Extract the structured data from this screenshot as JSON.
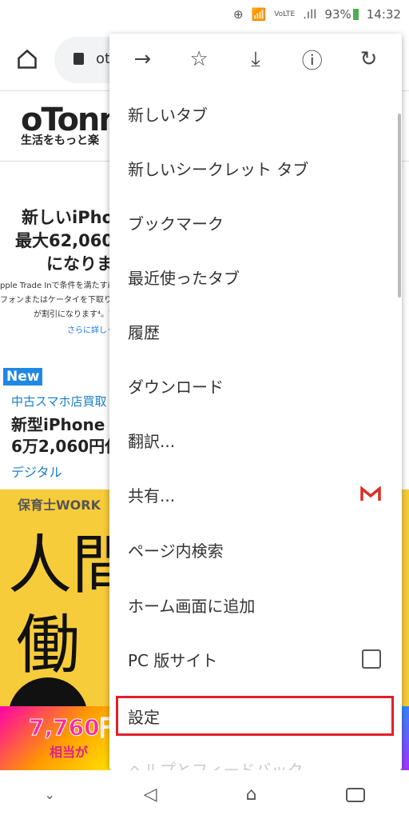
{
  "status_bar": {
    "battery": "93%",
    "time": "14:32",
    "icons": [
      "add-circle-icon",
      "wifi-icon",
      "volte-icon",
      "signal-icon",
      "battery-icon"
    ]
  },
  "toolbar": {
    "url_partial": "ot",
    "icons": [
      "home-icon",
      "lock-icon"
    ]
  },
  "page": {
    "logo": "oTonn",
    "tagline": "生活をもっと楽",
    "ad": {
      "h1": "新しいiPho",
      "h2": "最大62,060",
      "h3": "になりま",
      "s1": "pple Trade Inで条件を満たすi",
      "s2": "フォンまたはケータイを下取りに",
      "s3": "が割引になります⁴。下取りに",
      "link": "さらに詳しく"
    },
    "badge": "New",
    "article": {
      "category": "中古スマホ店買取",
      "title1": "新型iPhone",
      "title2": "6万2,060円仕",
      "tag": "デジタル"
    },
    "banner": {
      "brand": "保育士WORK",
      "big1": "人間",
      "big2": "働",
      "price": "7,760円",
      "sub": "相当が"
    }
  },
  "menu": {
    "top_icons": [
      "forward-icon",
      "star-icon",
      "download-icon",
      "info-icon",
      "reload-icon"
    ],
    "items": [
      {
        "label": "新しいタブ"
      },
      {
        "label": "新しいシークレット タブ"
      },
      {
        "label": "ブックマーク"
      },
      {
        "label": "最近使ったタブ"
      },
      {
        "label": "履歴"
      },
      {
        "label": "ダウンロード"
      },
      {
        "label": "翻訳..."
      },
      {
        "label": "共有...",
        "icon": "gmail-icon"
      },
      {
        "label": "ページ内検索"
      },
      {
        "label": "ホーム画面に追加"
      },
      {
        "label": "PC 版サイト",
        "checked": false
      },
      {
        "label": "設定",
        "highlighted": true,
        "highlight_color": "#e0202a"
      },
      {
        "label": "ヘルプとフィードバック"
      }
    ]
  },
  "nav_bar": {
    "icons": [
      "hide-keyboard-icon",
      "back-icon",
      "home-icon",
      "recents-icon"
    ]
  }
}
